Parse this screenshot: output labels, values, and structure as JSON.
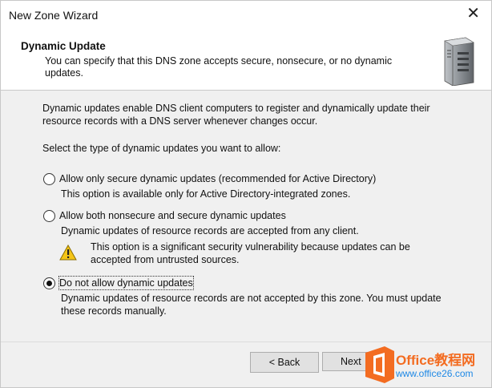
{
  "window": {
    "title": "New Zone Wizard",
    "close_glyph": "✕"
  },
  "header": {
    "title": "Dynamic Update",
    "subtitle_line1": "You can specify that this DNS zone accepts secure, nonsecure, or no dynamic",
    "subtitle_line2": "updates.",
    "icon": "server-icon"
  },
  "body": {
    "intro_line1": "Dynamic updates enable DNS client computers to register and dynamically update their",
    "intro_line2": "resource records with a DNS server whenever changes occur.",
    "prompt": "Select the type of dynamic updates you want to allow:",
    "options": [
      {
        "label": "Allow only secure dynamic updates (recommended for Active Directory)",
        "desc_line1": "This option is available only for Active Directory-integrated zones.",
        "selected": false
      },
      {
        "label": "Allow both nonsecure and secure dynamic updates",
        "desc_line1": "Dynamic updates of resource records are accepted from any client.",
        "warning_line1": "This option is a significant security vulnerability because updates can be",
        "warning_line2": "accepted from untrusted sources.",
        "selected": false
      },
      {
        "label": "Do not allow dynamic updates",
        "desc_line1": "Dynamic updates of resource records are not accepted by this zone. You must update",
        "desc_line2": "these records manually.",
        "selected": true
      }
    ]
  },
  "buttons": {
    "back": "< Back",
    "next": "Next"
  },
  "watermark": {
    "brand": "Office教程网",
    "url": "www.office26.com",
    "colors": {
      "orange": "#f36c21",
      "blue": "#1e88e5"
    }
  }
}
